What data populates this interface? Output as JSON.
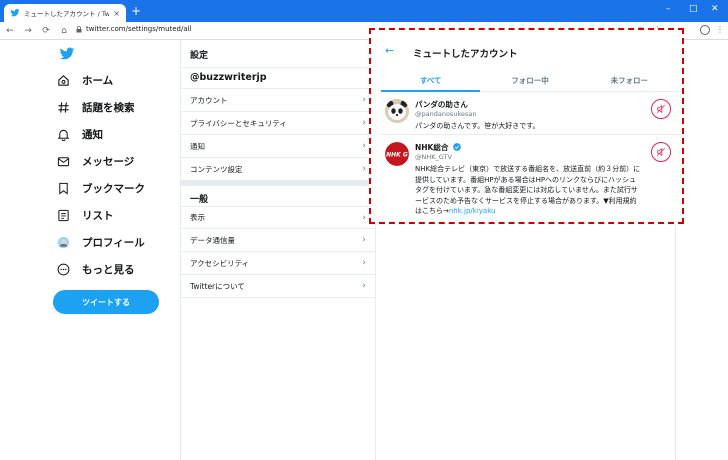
{
  "browser": {
    "tab_title": "ミュートしたアカウント / Twitter",
    "tab_close": "×",
    "new_tab": "+",
    "url": "twitter.com/settings/muted/all",
    "window_controls": [
      "–",
      "□",
      "✕"
    ],
    "nav": {
      "back": "←",
      "forward": "→",
      "reload": "⟳",
      "home": "⌂"
    },
    "right_icons": [
      "◎",
      "☆",
      "⋮"
    ]
  },
  "leftnav": {
    "items": [
      {
        "label": "ホーム",
        "icon": "home-icon"
      },
      {
        "label": "話題を検索",
        "icon": "hashtag-icon"
      },
      {
        "label": "通知",
        "icon": "bell-icon"
      },
      {
        "label": "メッセージ",
        "icon": "mail-icon"
      },
      {
        "label": "ブックマーク",
        "icon": "bookmark-icon"
      },
      {
        "label": "リスト",
        "icon": "list-icon"
      },
      {
        "label": "プロフィール",
        "icon": "avatar-icon"
      },
      {
        "label": "もっと見る",
        "icon": "more-icon"
      }
    ],
    "tweet_button": "ツイートする"
  },
  "settings": {
    "heading": "設定",
    "username": "@buzzwriterjp",
    "account_rows": [
      "アカウント",
      "プライバシーとセキュリティ",
      "通知",
      "コンテンツ設定"
    ],
    "general_heading": "一般",
    "general_rows": [
      "表示",
      "データ通信量",
      "アクセシビリティ",
      "Twitterについて"
    ],
    "chevron": "›"
  },
  "muted": {
    "back": "←",
    "title": "ミュートしたアカウント",
    "tabs": [
      "すべて",
      "フォロー中",
      "未フォロー"
    ],
    "active_tab": 0,
    "accounts": [
      {
        "name": "パンダの助さん",
        "handle": "@pandanosukesan",
        "bio": "パンダの助さんです。笹が大好きです。",
        "verified": false
      },
      {
        "name": "NHK総合",
        "handle": "@NHK_GTV",
        "bio": "NHK総合テレビ（東京）で放送する番組名を、放送直前（約３分前）に提供しています。番組HPがある場合はHPへのリンクならびにハッシュタグを付けています。急な番組変更には対応していません。また試行サービスのため予告なくサービスを停止する場合があります。▼利用規約はこちら→",
        "bio_link": "nhk.jp/kiyaku",
        "verified": true
      }
    ]
  },
  "colors": {
    "brand": "#1da1f2",
    "chrome": "#1a73e8",
    "mute": "#e0245e",
    "highlight": "#d00000"
  }
}
